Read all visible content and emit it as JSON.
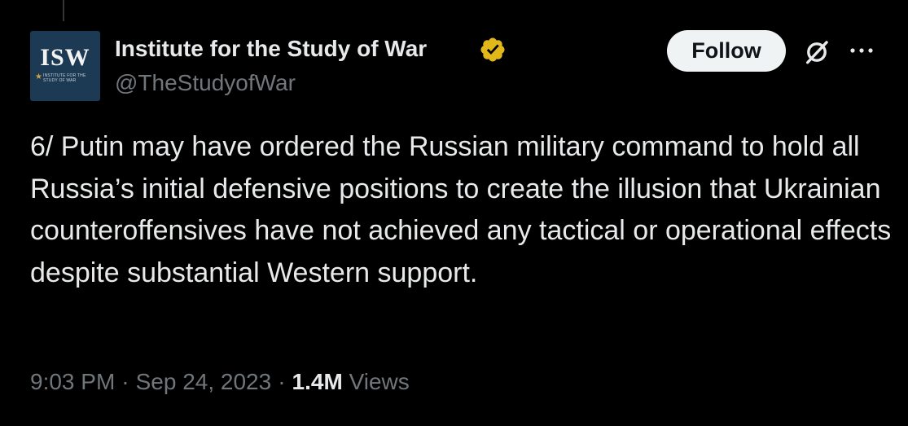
{
  "author": {
    "display_name": "Institute for the Study of War",
    "handle": "@TheStudyofWar",
    "avatar_logo": "ISW",
    "avatar_subtext": "INSTITUTE FOR THE STUDY OF WAR",
    "verified": true,
    "verified_color": "#e2b719"
  },
  "actions": {
    "follow_label": "Follow",
    "grok_icon": "grok-icon",
    "more_icon": "more-horizontal-icon"
  },
  "tweet": {
    "text": "6/ Putin may have ordered the Russian military command to hold all Russia’s initial defensive positions to create the illusion that Ukrainian counteroffensives have not achieved any tactical or operational effects despite substantial Western support."
  },
  "meta": {
    "time": "9:03 PM",
    "separator": "·",
    "date": "Sep 24, 2023",
    "views_count": "1.4M",
    "views_label": "Views"
  },
  "colors": {
    "background": "#000000",
    "primary_text": "#e7e9ea",
    "secondary_text": "#71767b",
    "follow_bg": "#eff3f4",
    "avatar_bg": "#1d3a55"
  }
}
